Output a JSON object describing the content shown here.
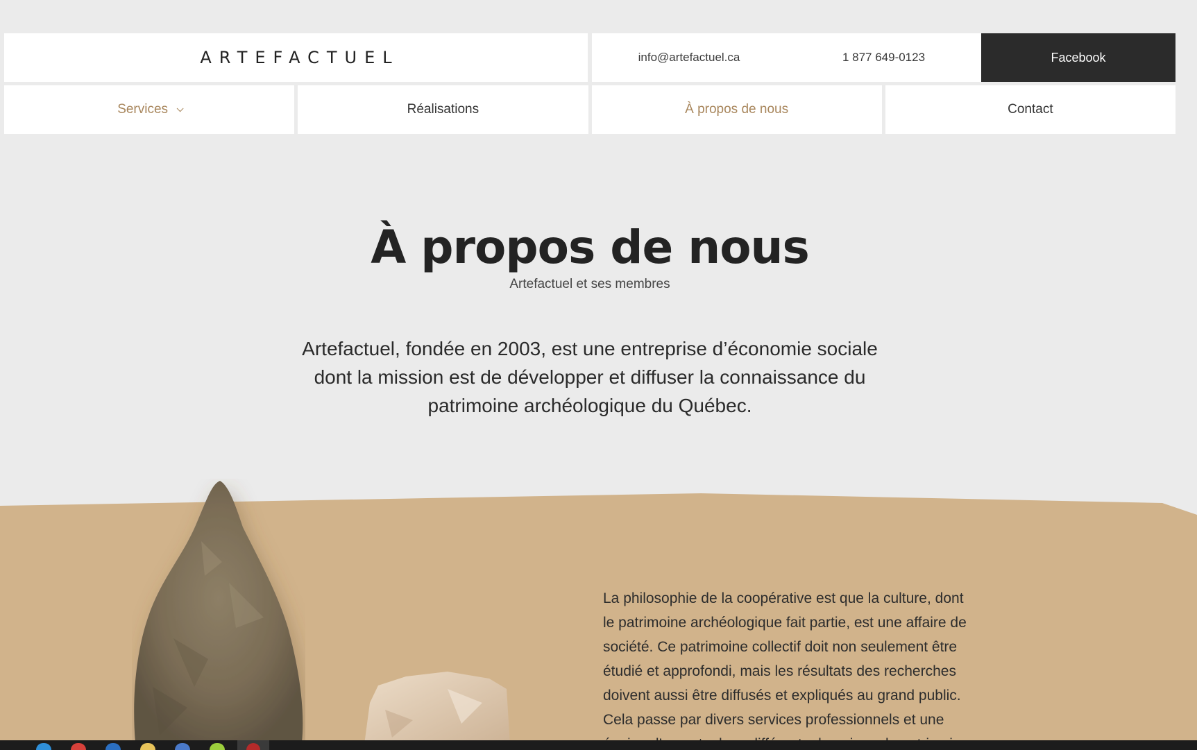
{
  "header": {
    "logo_text": "ARTEFACTUEL",
    "email": "info@artefactuel.ca",
    "phone": "1 877 649-0123",
    "facebook_label": "Facebook"
  },
  "nav": {
    "items": [
      {
        "label": "Services",
        "has_dropdown": true,
        "active": true
      },
      {
        "label": "Réalisations",
        "has_dropdown": false,
        "active": false
      },
      {
        "label": "À propos de nous",
        "has_dropdown": false,
        "active": true
      },
      {
        "label": "Contact",
        "has_dropdown": false,
        "active": false
      }
    ],
    "dropdown_icon": "chevron-down-icon"
  },
  "hero": {
    "title": "À propos de nous",
    "subtitle": "Artefactuel et ses membres",
    "lead": "Artefactuel, fondée en 2003, est une entreprise d’économie sociale dont la mission est de développer et diffuser la connaissance du patrimoine archéologique du Québec."
  },
  "section": {
    "paragraph": "La philosophie de la coopérative est que la culture, dont le patrimoine archéologique fait partie, est une affaire de société. Ce patrimoine collectif doit non seulement être étudié et approfondi, mais les résultats des recherches doivent aussi être diffusés et expliqués au grand public. Cela passe par divers services professionnels et une équipe d’experts dans différents domaines du patrimoine."
  },
  "colors": {
    "background": "#ebebeb",
    "accent": "#a8865c",
    "sand": "#d1b38b",
    "dark_button": "#2b2b2b"
  },
  "taskbar": {
    "icons": [
      "browser-icon",
      "chrome-icon",
      "edge-icon",
      "folder-icon",
      "store-icon",
      "app-icon",
      "active-app-icon"
    ]
  }
}
